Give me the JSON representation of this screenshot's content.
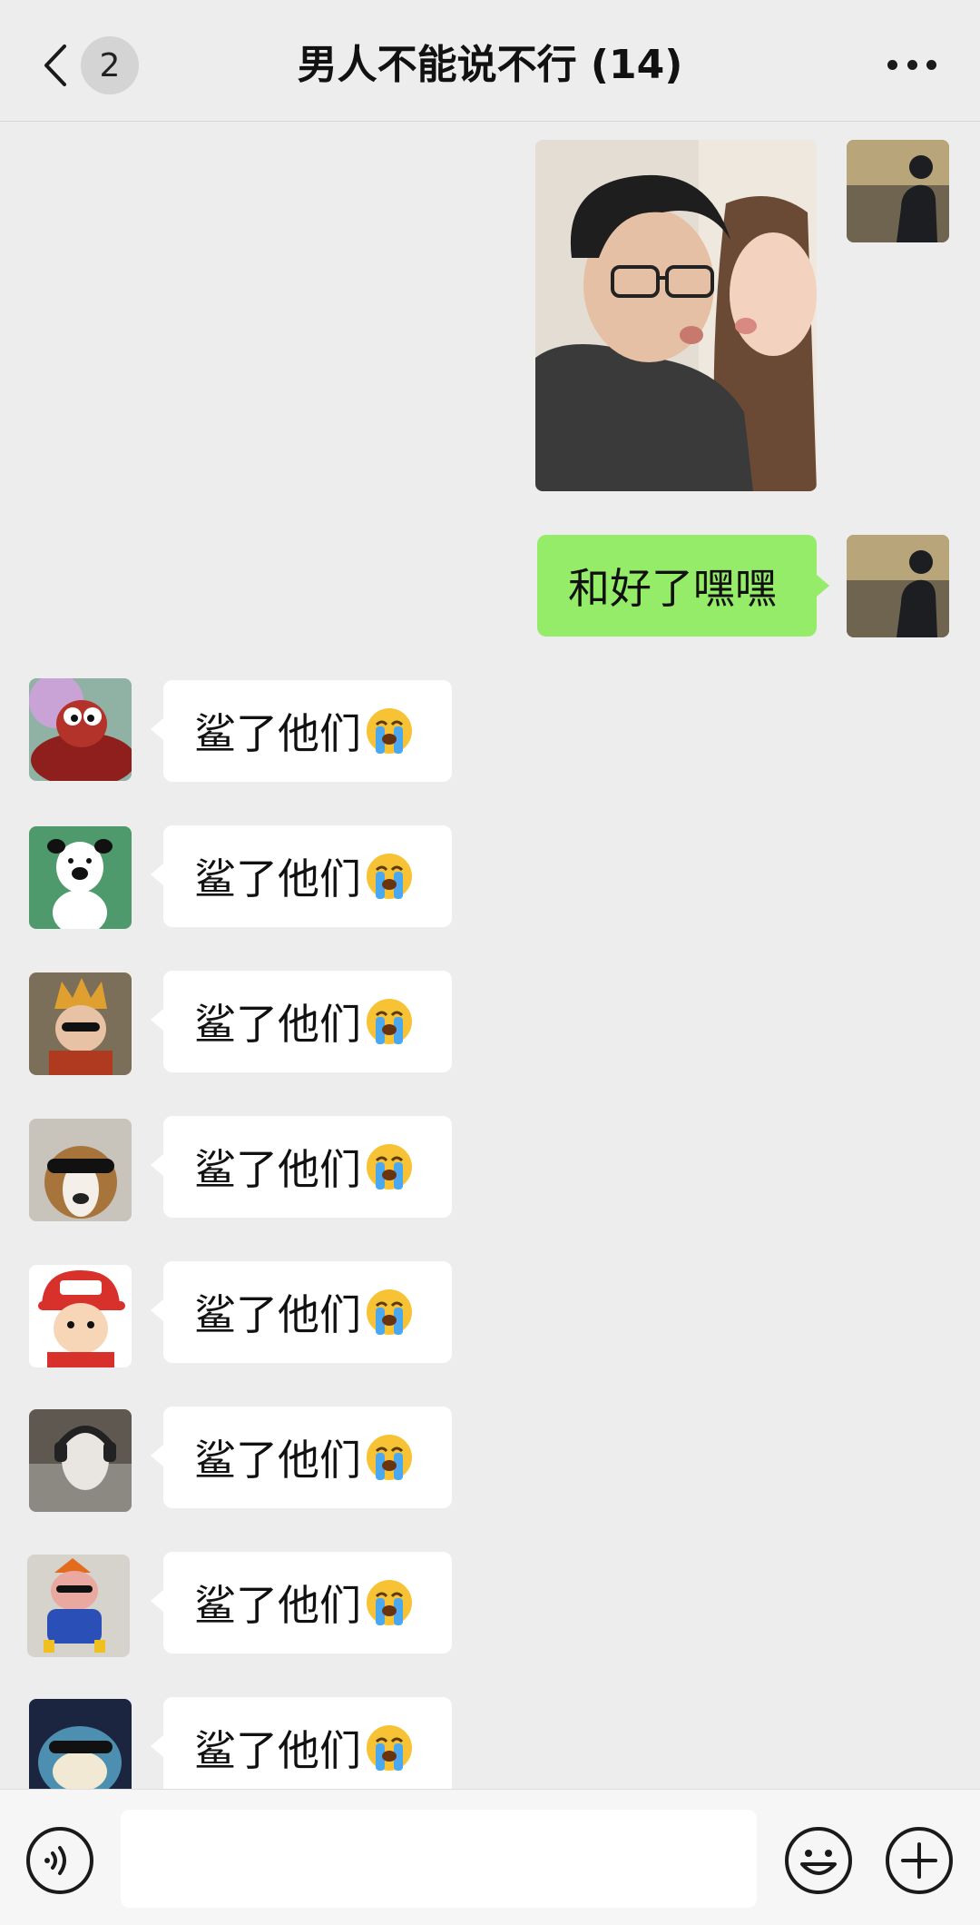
{
  "header": {
    "back_label": "返回",
    "unread_count": "2",
    "title": "男人不能说不行 (14)"
  },
  "messages": {
    "sent_text": "和好了嘿嘿",
    "received_text": "鲨了他们",
    "received_emoji_name": "loudly-crying-face"
  },
  "colors": {
    "background": "#ededed",
    "sent_bubble": "#95ec69",
    "received_bubble": "#ffffff"
  },
  "input": {
    "value": "",
    "placeholder": ""
  }
}
